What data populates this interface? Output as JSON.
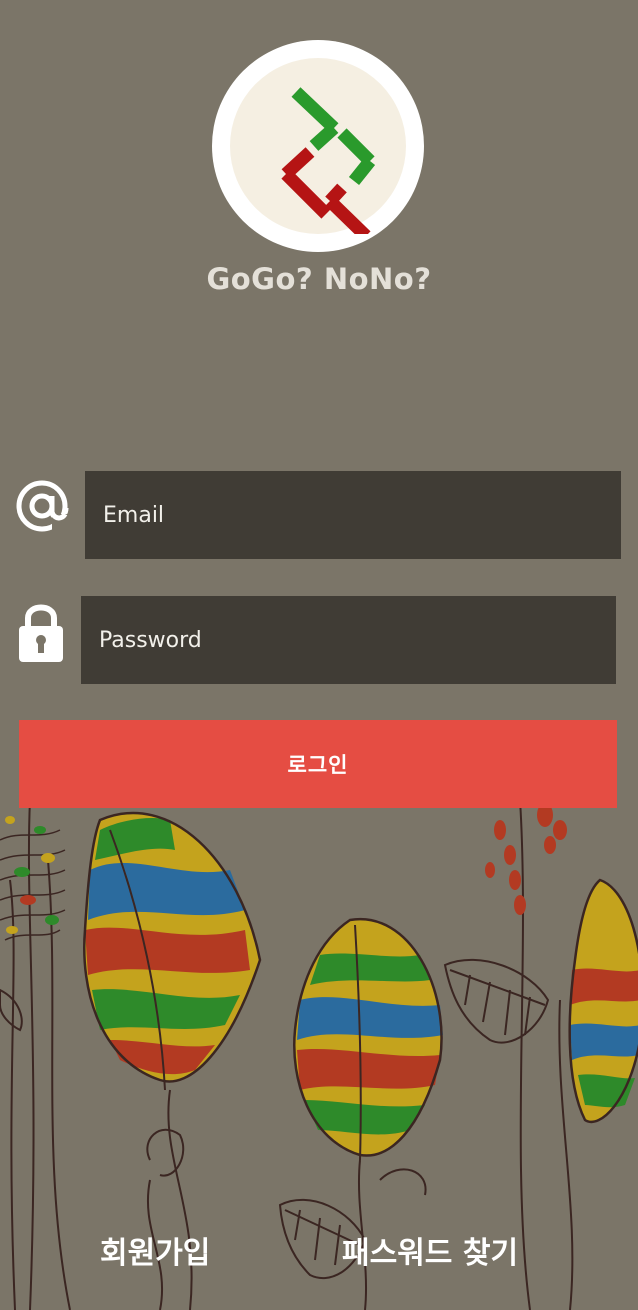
{
  "app": {
    "title": "GoGo? NoNo?"
  },
  "login_form": {
    "email_placeholder": "Email",
    "password_placeholder": "Password",
    "login_label": "로그인"
  },
  "links": {
    "signup_label": "회원가입",
    "forgot_password_label": "패스워드 찾기"
  },
  "icons": {
    "logo": "app-logo",
    "email": "at-sign-icon",
    "password": "lock-icon"
  },
  "colors": {
    "background": "#7b7568",
    "input_background": "#403c35",
    "login_button": "#e54d43",
    "logo_green": "#2a9a2c",
    "logo_red": "#b51414"
  }
}
